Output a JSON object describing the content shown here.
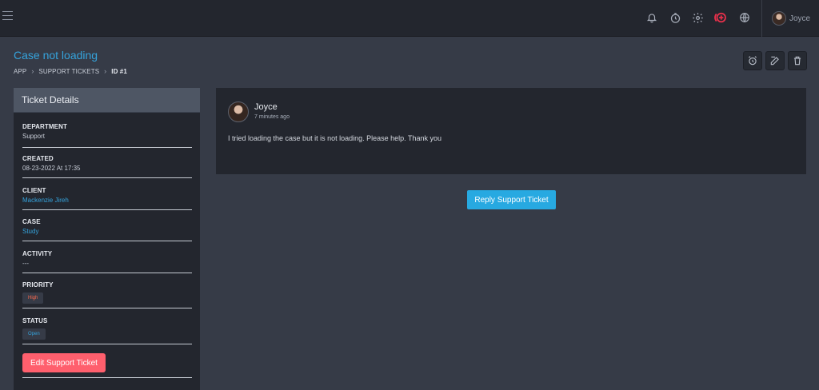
{
  "topbar": {
    "icons": [
      "bell-icon",
      "timer-icon",
      "gear-icon",
      "add-circle-icon",
      "globe-icon"
    ],
    "user_name": "Joyce",
    "accent_add_color": "#e8304b"
  },
  "page": {
    "title": "Case not loading",
    "breadcrumb": [
      "APP",
      "SUPPORT TICKETS",
      "ID #1"
    ],
    "actions": [
      "alarm-icon",
      "edit-icon",
      "trash-icon"
    ]
  },
  "details": {
    "header": "Ticket Details",
    "department_label": "DEPARTMENT",
    "department": "Support",
    "created_label": "CREATED",
    "created": "08-23-2022 At 17:35",
    "client_label": "CLIENT",
    "client": "Mackenzie Jireh",
    "case_label": "CASE",
    "case": "Study",
    "activity_label": "ACTIVITY",
    "activity": "---",
    "priority_label": "PRIORITY",
    "priority": "High",
    "status_label": "STATUS",
    "status": "Open",
    "edit_button": "Edit Support Ticket"
  },
  "message": {
    "author": "Joyce",
    "time": "7 minutes ago",
    "body": "I tried loading the case but it is not loading. Please help. Thank you"
  },
  "reply_button": "Reply Support Ticket",
  "colors": {
    "accent": "#35a3dc",
    "danger": "#ff5f6d",
    "reply": "#27a9e1",
    "background": "#363b47",
    "panel": "#23262e"
  }
}
